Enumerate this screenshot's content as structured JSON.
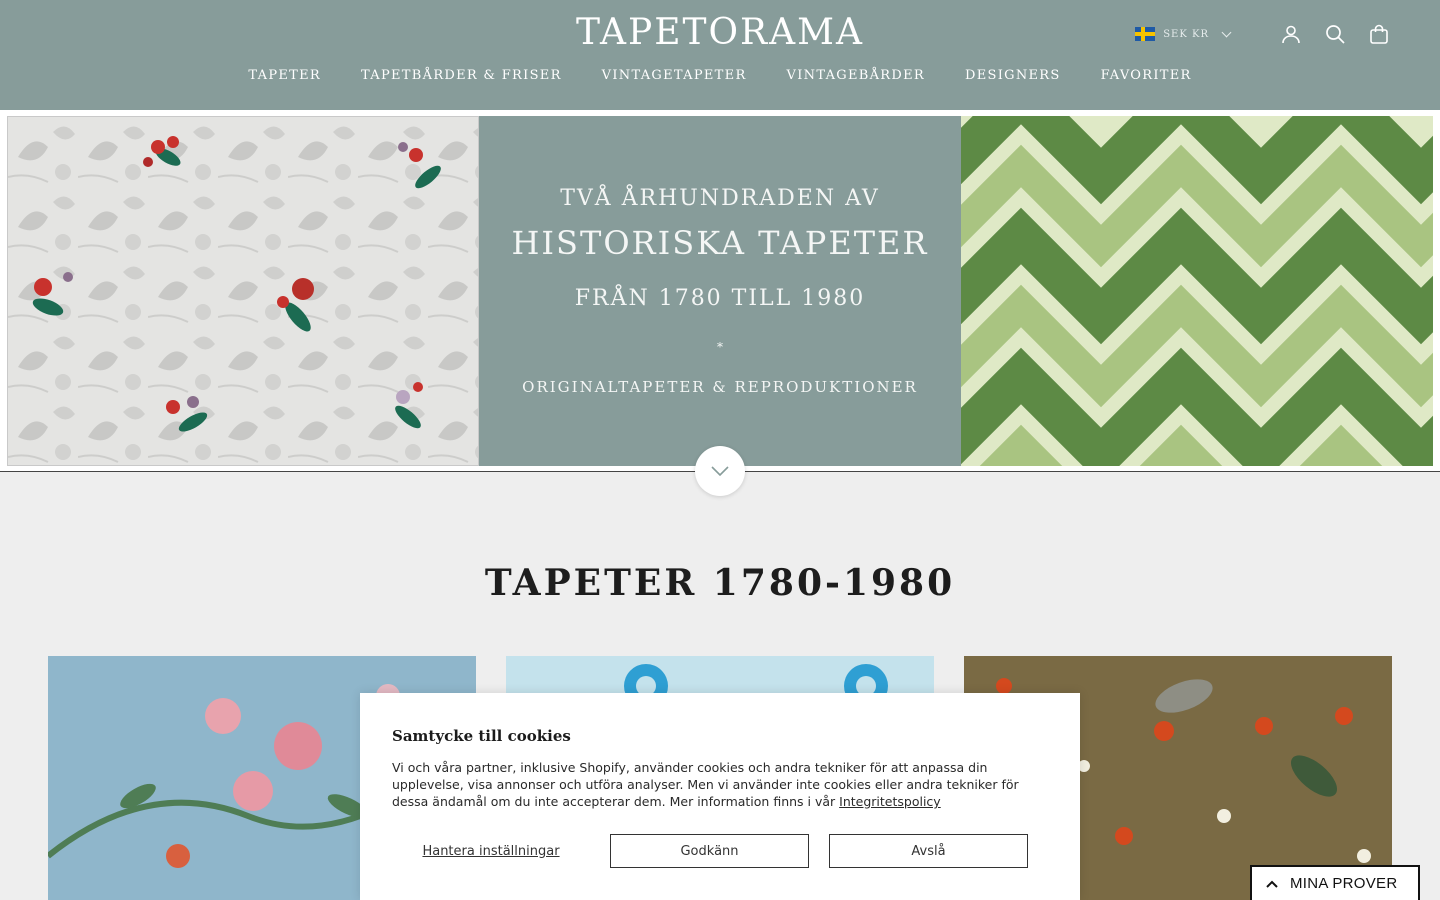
{
  "header": {
    "logo": "TAPETORAMA",
    "currency": "SEK KR",
    "icons": [
      "account-icon",
      "search-icon",
      "cart-icon"
    ],
    "nav": [
      {
        "label": "TAPETER"
      },
      {
        "label": "TAPETBÅRDER & FRISER"
      },
      {
        "label": "VINTAGETAPETER"
      },
      {
        "label": "VINTAGEBÅRDER"
      },
      {
        "label": "DESIGNERS"
      },
      {
        "label": "FAVORITER"
      }
    ]
  },
  "hero": {
    "line1": "TVÅ ÅRHUNDRADEN AV",
    "line2": "HISTORISKA TAPETER",
    "line3": "FRÅN 1780 TILL 1980",
    "separator": "*",
    "line4": "ORIGINALTAPETER & REPRODUKTIONER"
  },
  "section": {
    "title": "TAPETER 1780-1980"
  },
  "cookie": {
    "title": "Samtycke till cookies",
    "text": "Vi och våra partner, inklusive Shopify, använder cookies och andra tekniker för att anpassa din upplevelse, visa annonser och utföra analyser. Men vi använder inte cookies eller andra tekniker för dessa ändamål om du inte accepterar dem. Mer information finns i vår",
    "policy_link": "Integritetspolicy",
    "manage": "Hantera inställningar",
    "accept": "Godkänn",
    "reject": "Avslå"
  },
  "samples": {
    "label": "MINA PROVER"
  },
  "colors": {
    "header_bg": "#879c9a",
    "page_bg": "#eeeeee"
  }
}
